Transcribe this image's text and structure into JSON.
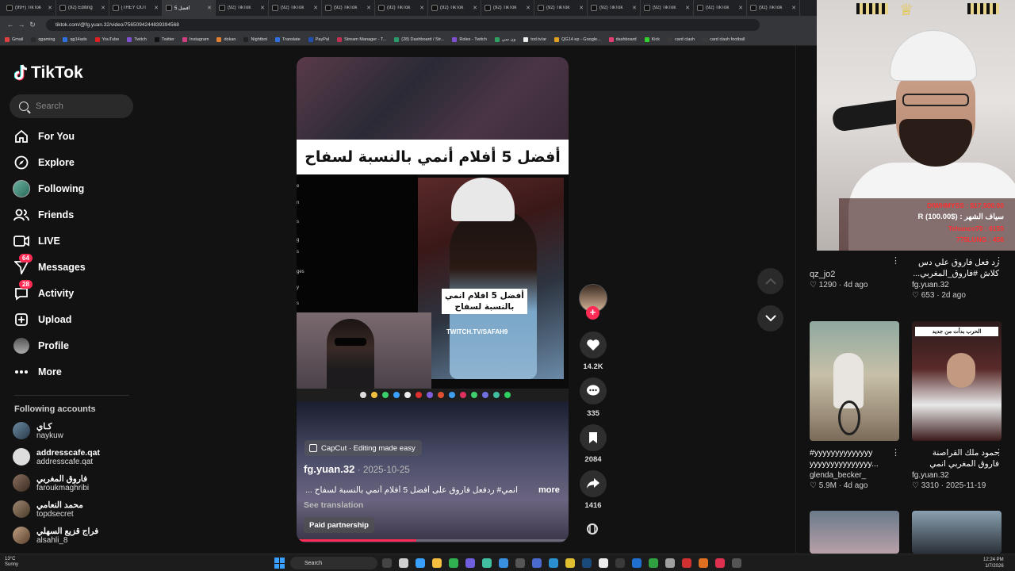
{
  "browser": {
    "tabs": [
      {
        "title": "(99+) TikTok",
        "active": false
      },
      {
        "title": "(92) Editing",
        "active": false
      },
      {
        "title": "[THEY OUT",
        "active": false
      },
      {
        "title": "أفضل 5",
        "active": true
      },
      {
        "title": "(92) TikTok",
        "active": false
      },
      {
        "title": "(92) TikTok",
        "active": false
      },
      {
        "title": "(92) TikTok",
        "active": false
      },
      {
        "title": "(92) TikTok",
        "active": false
      },
      {
        "title": "(92) TikTok",
        "active": false
      },
      {
        "title": "(92) TikTok",
        "active": false
      },
      {
        "title": "(92) TikTok",
        "active": false
      },
      {
        "title": "(92) TikTok",
        "active": false
      },
      {
        "title": "(92) TikTok",
        "active": false
      },
      {
        "title": "(92) TikTok",
        "active": false
      },
      {
        "title": "(92) TikTok",
        "active": false
      }
    ],
    "url": "tiktok.com/@fg.yuan.32/video/7565094244839394568",
    "bookmarks": [
      "Gmail",
      "qgaming",
      "qg14ads",
      "YouTube",
      "Twitch",
      "Twitter",
      "Instagram",
      "dokan",
      "Nightbot",
      "Translate",
      "PayPal",
      "Stream Manager - T...",
      "(28) Dashboard / Str...",
      "Roles - Twitch",
      "ون سي",
      "tod.tv/ar",
      "QG14 ep - Google...",
      "dashboard",
      "Kick",
      "card clash",
      "card clash football"
    ]
  },
  "sidebar": {
    "logo": "TikTok",
    "search_placeholder": "Search",
    "nav": [
      {
        "label": "For You",
        "icon": "home-icon"
      },
      {
        "label": "Explore",
        "icon": "compass-icon"
      },
      {
        "label": "Following",
        "icon": "following-avatar-icon"
      },
      {
        "label": "Friends",
        "icon": "friends-icon"
      },
      {
        "label": "LIVE",
        "icon": "live-icon"
      },
      {
        "label": "Messages",
        "icon": "messages-icon",
        "badge": "64"
      },
      {
        "label": "Activity",
        "icon": "activity-icon",
        "badge": "28"
      },
      {
        "label": "Upload",
        "icon": "upload-icon"
      },
      {
        "label": "Profile",
        "icon": "profile-avatar-icon"
      },
      {
        "label": "More",
        "icon": "more-icon"
      }
    ],
    "following_title": "Following accounts",
    "following": [
      {
        "name": "كـاي",
        "handle": "naykuw"
      },
      {
        "name": "addresscafe.qat",
        "handle": "addresscafe.qat"
      },
      {
        "name": "فاروق المغربي",
        "handle": "faroukmaghribi"
      },
      {
        "name": "محمد النعامي",
        "handle": "topdsecret"
      },
      {
        "name": "فراج قزيع السهلي",
        "handle": "alsahli_8"
      }
    ]
  },
  "video": {
    "overlay_title": "أفضل 5 أفلام أنمي بالنسبة لسفاح",
    "sticker_line1": "أفضل 5 افلام انمي",
    "sticker_line2": "بالنسبة لسفاح",
    "twitch_text": "TWITCH.TV/SAFAH9",
    "capcut": "CapCut · Editing made easy",
    "author": "fg.yuan.32",
    "date": "2025-10-25",
    "description": "انمي# ردفعل فاروق على أفضل 5 أفلام أنمي بالنسبة لسفاح ...",
    "more": "more",
    "see_translation": "See translation",
    "paid": "Paid partnership",
    "progress": 0.44
  },
  "actions": {
    "likes": "14.2K",
    "comments": "335",
    "saves": "2084",
    "shares": "1416"
  },
  "related": [
    {
      "title": "",
      "author": "qz_jo2",
      "likes": "1290",
      "date": "4d ago"
    },
    {
      "title": "رد فعل فاروق علي دس كلاش #فاروق_المغربي...",
      "author": "fg.yuan.32",
      "likes": "653",
      "date": "2d ago"
    },
    {
      "title": "#yyyyyyyyyyyyyy yyyyyyyyyyyyyyy...",
      "author": "glenda_becker_",
      "likes": "5.9M",
      "date": "4d ago"
    },
    {
      "title": "حمود ملك القراصنة فاروق المغربي انمي بلينش ايزن",
      "author": "fg.yuan.32",
      "likes": "3310",
      "date": "2025-11-19"
    }
  ],
  "thumb_label": "الحرب بدأت من جديد",
  "stream_overlay": {
    "line1": "DIWHMYSS : $17,500.00",
    "line2": "سياف الشهر : ($100.00) R",
    "line3": "Tehanco70 : 6155",
    "line4": "775LUNG : 456"
  },
  "taskbar": {
    "weather_temp": "13°C",
    "weather_desc": "Sunny",
    "search": "Search",
    "time": "12:24 PM",
    "date": "1/7/2026"
  }
}
